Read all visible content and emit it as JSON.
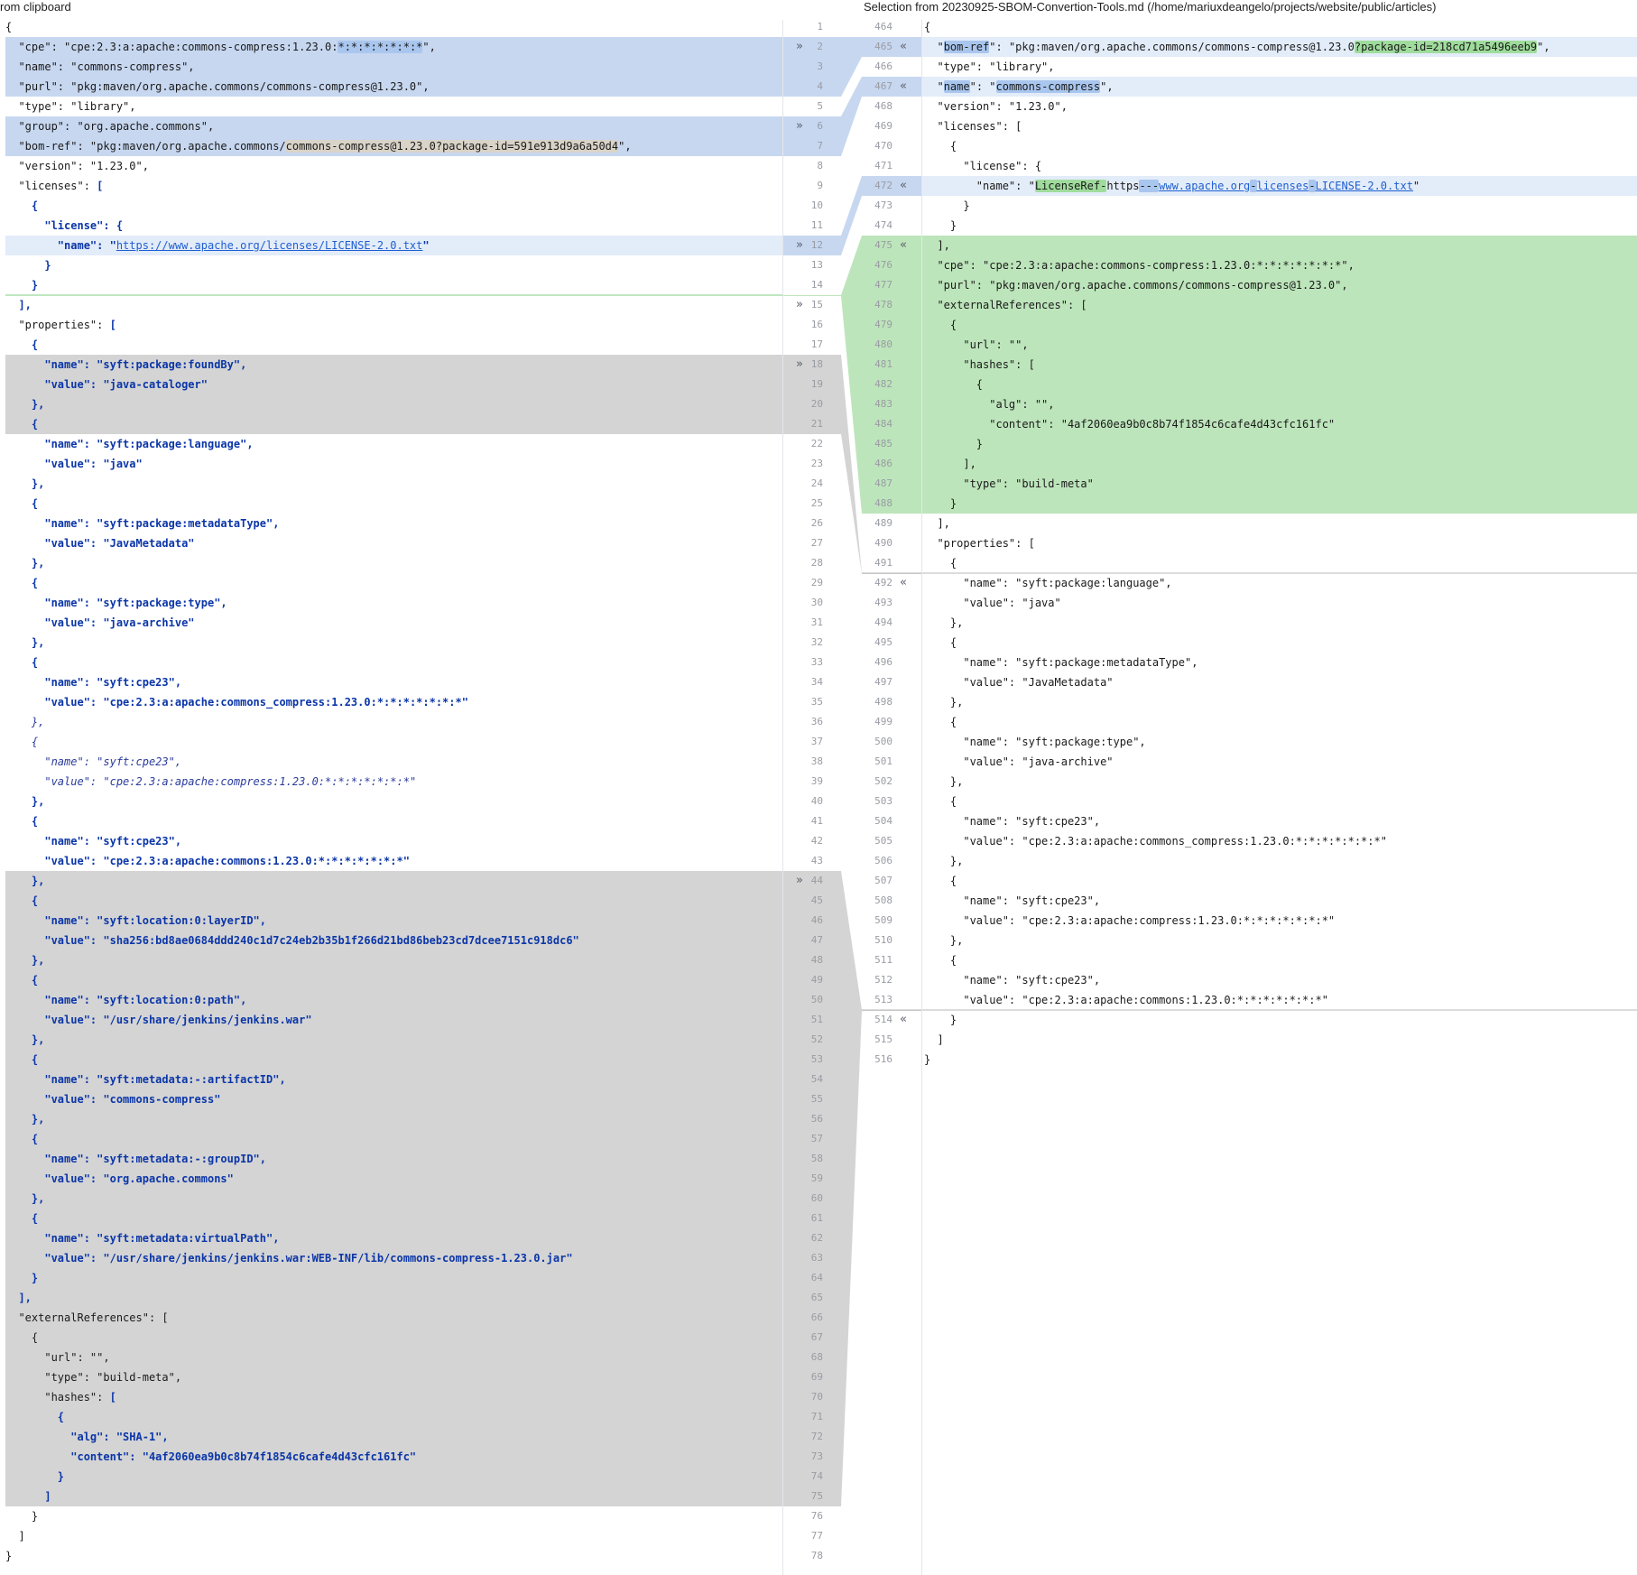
{
  "headers": {
    "left": "rom clipboard",
    "right": "Selection from 20230925-SBOM-Convertion-Tools.md (/home/mariuxdeangelo/projects/website/public/articles)"
  },
  "left": {
    "lines": [
      [
        "{"
      ],
      [
        "  \"cpe\": \"cpe:2.3:a:apache:commons-compress:1.23.0:",
        [
          "blue",
          "*:*:*:*:*:*:*"
        ],
        "\","
      ],
      [
        "  \"name\": \"commons-compress\","
      ],
      [
        "  \"purl\": \"pkg:maven/org.apache.commons/commons-compress@1.23.0\","
      ],
      [
        "  \"type\": \"library\","
      ],
      [
        "  \"group\": \"org.apache.commons\","
      ],
      [
        "  \"bom-ref\": \"pkg:maven/org.apache.commons/",
        [
          "tan",
          "commons-compress@1.23.0?package-id=591e913d9a6a50d4"
        ],
        "\","
      ],
      [
        "  \"version\": \"1.23.0\","
      ],
      [
        "  \"licenses\": ",
        [
          "kw",
          "["
        ]
      ],
      [
        "    ",
        [
          "kw",
          "{"
        ]
      ],
      [
        "      ",
        [
          "kw",
          "\"license\": {"
        ]
      ],
      [
        "        ",
        [
          "kw",
          "\"name\": \""
        ],
        [
          "link",
          "https://www.apache.org/licenses/LICENSE-2.0.txt"
        ],
        [
          "kw",
          "\""
        ]
      ],
      [
        "      ",
        [
          "kw",
          "}"
        ]
      ],
      [
        "    ",
        [
          "kw",
          "}"
        ]
      ],
      [
        "  ",
        [
          "kw",
          "],"
        ]
      ],
      [
        "  \"properties\": ",
        [
          "kw",
          "["
        ]
      ],
      [
        "    ",
        [
          "kw",
          "{"
        ]
      ],
      [
        "      ",
        [
          "kw",
          "\"name\": \"syft:package:foundBy\","
        ]
      ],
      [
        "      ",
        [
          "kw",
          "\"value\": \"java-cataloger\""
        ]
      ],
      [
        "    ",
        [
          "kw",
          "},"
        ]
      ],
      [
        "    ",
        [
          "kw",
          "{"
        ]
      ],
      [
        "      ",
        [
          "kw",
          "\"name\": \"syft:package:language\","
        ]
      ],
      [
        "      ",
        [
          "kw",
          "\"value\": \"java\""
        ]
      ],
      [
        "    ",
        [
          "kw",
          "},"
        ]
      ],
      [
        "    ",
        [
          "kw",
          "{"
        ]
      ],
      [
        "      ",
        [
          "kw",
          "\"name\": \"syft:package:metadataType\","
        ]
      ],
      [
        "      ",
        [
          "kw",
          "\"value\": \"JavaMetadata\""
        ]
      ],
      [
        "    ",
        [
          "kw",
          "},"
        ]
      ],
      [
        "    ",
        [
          "kw",
          "{"
        ]
      ],
      [
        "      ",
        [
          "kw",
          "\"name\": \"syft:package:type\","
        ]
      ],
      [
        "      ",
        [
          "kw",
          "\"value\": \"java-archive\""
        ]
      ],
      [
        "    ",
        [
          "kw",
          "},"
        ]
      ],
      [
        "    ",
        [
          "kw",
          "{"
        ]
      ],
      [
        "      ",
        [
          "kw",
          "\"name\": \"syft:cpe23\","
        ]
      ],
      [
        "      ",
        [
          "kw",
          "\"value\": \"cpe:2.3:a:apache:commons_compress:1.23.0:*:*:*:*:*:*:*\""
        ]
      ],
      [
        "    ",
        [
          "it",
          "},"
        ]
      ],
      [
        "    ",
        [
          "it",
          "{"
        ]
      ],
      [
        "      ",
        [
          "it",
          "\"name\": \"syft:cpe23\","
        ]
      ],
      [
        "      ",
        [
          "it",
          "\"value\": \"cpe:2.3:a:apache:compress:1.23.0:*:*:*:*:*:*:*\""
        ]
      ],
      [
        "    ",
        [
          "kw",
          "},"
        ]
      ],
      [
        "    ",
        [
          "kw",
          "{"
        ]
      ],
      [
        "      ",
        [
          "kw",
          "\"name\": \"syft:cpe23\","
        ]
      ],
      [
        "      ",
        [
          "kw",
          "\"value\": \"cpe:2.3:a:apache:commons:1.23.0:*:*:*:*:*:*:*\""
        ]
      ],
      [
        "    ",
        [
          "kw",
          "},"
        ]
      ],
      [
        "    ",
        [
          "kw",
          "{"
        ]
      ],
      [
        "      ",
        [
          "kw",
          "\"name\": \"syft:location:0:layerID\","
        ]
      ],
      [
        "      ",
        [
          "kw",
          "\"value\": \"sha256:bd8ae0684ddd240c1d7c24eb2b35b1f266d21bd86beb23cd7dcee7151c918dc6\""
        ]
      ],
      [
        "    ",
        [
          "kw",
          "},"
        ]
      ],
      [
        "    ",
        [
          "kw",
          "{"
        ]
      ],
      [
        "      ",
        [
          "kw",
          "\"name\": \"syft:location:0:path\","
        ]
      ],
      [
        "      ",
        [
          "kw",
          "\"value\": \"/usr/share/jenkins/jenkins.war\""
        ]
      ],
      [
        "    ",
        [
          "kw",
          "},"
        ]
      ],
      [
        "    ",
        [
          "kw",
          "{"
        ]
      ],
      [
        "      ",
        [
          "kw",
          "\"name\": \"syft:metadata:-:artifactID\","
        ]
      ],
      [
        "      ",
        [
          "kw",
          "\"value\": \"commons-compress\""
        ]
      ],
      [
        "    ",
        [
          "kw",
          "},"
        ]
      ],
      [
        "    ",
        [
          "kw",
          "{"
        ]
      ],
      [
        "      ",
        [
          "kw",
          "\"name\": \"syft:metadata:-:groupID\","
        ]
      ],
      [
        "      ",
        [
          "kw",
          "\"value\": \"org.apache.commons\""
        ]
      ],
      [
        "    ",
        [
          "kw",
          "},"
        ]
      ],
      [
        "    ",
        [
          "kw",
          "{"
        ]
      ],
      [
        "      ",
        [
          "kw",
          "\"name\": \"syft:metadata:virtualPath\","
        ]
      ],
      [
        "      ",
        [
          "kw",
          "\"value\": \"/usr/share/jenkins/jenkins.war:WEB-INF/lib/commons-compress-1.23.0.jar\""
        ]
      ],
      [
        "    ",
        [
          "kw",
          "}"
        ]
      ],
      [
        "  ",
        [
          "kw",
          "],"
        ]
      ],
      [
        "  \"externalReferences\": ["
      ],
      [
        "    {"
      ],
      [
        "      \"url\": \"\","
      ],
      [
        "      \"type\": \"build-meta\","
      ],
      [
        "      \"hashes\": ",
        [
          "kw",
          "["
        ]
      ],
      [
        "        ",
        [
          "kw",
          "{"
        ]
      ],
      [
        "          ",
        [
          "kw",
          "\"alg\": \"SHA-1\","
        ]
      ],
      [
        "          ",
        [
          "kw",
          "\"content\": \"4af2060ea9b0c8b74f1854c6cafe4d43cfc161fc\""
        ]
      ],
      [
        "        ",
        [
          "kw",
          "}"
        ]
      ],
      [
        "      ",
        [
          "kw",
          "]"
        ]
      ],
      [
        "    }"
      ],
      [
        "  ]"
      ],
      [
        "}"
      ]
    ]
  },
  "right": {
    "lines": [
      [
        "{"
      ],
      [
        "  \"",
        [
          "blue",
          "bom-ref"
        ],
        "\": \"pkg:maven/org.apache.commons/commons-compress@1.23.0",
        [
          "green",
          "?package-id=218cd71a5496eeb9"
        ],
        "\","
      ],
      [
        "  \"type\": \"library\","
      ],
      [
        "  \"",
        [
          "blue",
          "name"
        ],
        "\": \"",
        [
          "blue",
          "commons-compress"
        ],
        "\","
      ],
      [
        "  \"version\": \"1.23.0\","
      ],
      [
        "  \"licenses\": ["
      ],
      [
        "    {"
      ],
      [
        "      \"license\": {"
      ],
      [
        "        \"name\": \"",
        [
          "green",
          "LicenseRef-"
        ],
        "https",
        [
          "blue",
          "---"
        ],
        [
          "link",
          "www.apache.org"
        ],
        [
          "blue",
          "-"
        ],
        [
          "link",
          "licenses"
        ],
        [
          "blue",
          "-"
        ],
        [
          "link",
          "LICENSE-2.0.txt"
        ],
        "\""
      ],
      [
        "      }"
      ],
      [
        "    }"
      ],
      [
        "  ],"
      ],
      [
        "  \"cpe\": \"cpe:2.3:a:apache:commons-compress:1.23.0:*:*:*:*:*:*:*\","
      ],
      [
        "  \"purl\": \"pkg:maven/org.apache.commons/commons-compress@1.23.0\","
      ],
      [
        "  \"externalReferences\": ["
      ],
      [
        "    {"
      ],
      [
        "      \"url\": \"\","
      ],
      [
        "      \"hashes\": ["
      ],
      [
        "        {"
      ],
      [
        "          \"alg\": \"\","
      ],
      [
        "          \"content\": \"4af2060ea9b0c8b74f1854c6cafe4d43cfc161fc\""
      ],
      [
        "        }"
      ],
      [
        "      ],"
      ],
      [
        "      \"type\": \"build-meta\""
      ],
      [
        "    }"
      ],
      [
        "  ],"
      ],
      [
        "  \"properties\": ["
      ],
      [
        "    {"
      ],
      [
        "      \"name\": \"syft:package:language\","
      ],
      [
        "      \"value\": \"java\""
      ],
      [
        "    },"
      ],
      [
        "    {"
      ],
      [
        "      \"name\": \"syft:package:metadataType\","
      ],
      [
        "      \"value\": \"JavaMetadata\""
      ],
      [
        "    },"
      ],
      [
        "    {"
      ],
      [
        "      \"name\": \"syft:package:type\","
      ],
      [
        "      \"value\": \"java-archive\""
      ],
      [
        "    },"
      ],
      [
        "    {"
      ],
      [
        "      \"name\": \"syft:cpe23\","
      ],
      [
        "      \"value\": \"cpe:2.3:a:apache:commons_compress:1.23.0:*:*:*:*:*:*:*\""
      ],
      [
        "    },"
      ],
      [
        "    {"
      ],
      [
        "      \"name\": \"syft:cpe23\","
      ],
      [
        "      \"value\": \"cpe:2.3:a:apache:compress:1.23.0:*:*:*:*:*:*:*\""
      ],
      [
        "    },"
      ],
      [
        "    {"
      ],
      [
        "      \"name\": \"syft:cpe23\","
      ],
      [
        "      \"value\": \"cpe:2.3:a:apache:commons:1.23.0:*:*:*:*:*:*:*\""
      ],
      [
        "    }"
      ],
      [
        "  ]"
      ],
      [
        "}"
      ]
    ]
  },
  "left_line_numbers": [
    "1",
    "2",
    "3",
    "4",
    "5",
    "6",
    "7",
    "8",
    "9",
    "10",
    "11",
    "12",
    "13",
    "14",
    "15",
    "16",
    "17",
    "18",
    "19",
    "20",
    "21",
    "22",
    "23",
    "24",
    "25",
    "26",
    "27",
    "28",
    "29",
    "30",
    "31",
    "32",
    "33",
    "34",
    "35",
    "36",
    "37",
    "38",
    "39",
    "40",
    "41",
    "42",
    "43",
    "44",
    "45",
    "46",
    "47",
    "48",
    "49",
    "50",
    "51",
    "52",
    "53",
    "54",
    "55",
    "56",
    "57",
    "58",
    "59",
    "60",
    "61",
    "62",
    "63",
    "64",
    "65",
    "66",
    "67",
    "68",
    "69",
    "70",
    "71",
    "72",
    "73",
    "74",
    "75",
    "76",
    "77",
    "78"
  ],
  "right_line_numbers": [
    "464",
    "465",
    "466",
    "467",
    "468",
    "469",
    "470",
    "471",
    "472",
    "473",
    "474",
    "475",
    "476",
    "477",
    "478",
    "479",
    "480",
    "481",
    "482",
    "483",
    "484",
    "485",
    "486",
    "487",
    "488",
    "489",
    "490",
    "491",
    "492",
    "493",
    "494",
    "495",
    "496",
    "497",
    "498",
    "499",
    "500",
    "501",
    "502",
    "503",
    "504",
    "505",
    "506",
    "507",
    "508",
    "509",
    "510",
    "511",
    "512",
    "513",
    "514",
    "515",
    "516"
  ],
  "gutter": {
    "accept_left": "»",
    "accept_right": "«",
    "left_arrow_lines": [
      2,
      6,
      12,
      15,
      18,
      44
    ],
    "right_arrow_lines": [
      465,
      467,
      472,
      475,
      492,
      514
    ]
  },
  "colors": {
    "changed_blue": "#c7d7f0",
    "changed_blue_light": "#e3ecf9",
    "inserted_green": "#bde5bb",
    "deleted_gray": "#d4d4d4",
    "keyword_blue": "#0b36a8",
    "text": "#1a1a1a"
  }
}
